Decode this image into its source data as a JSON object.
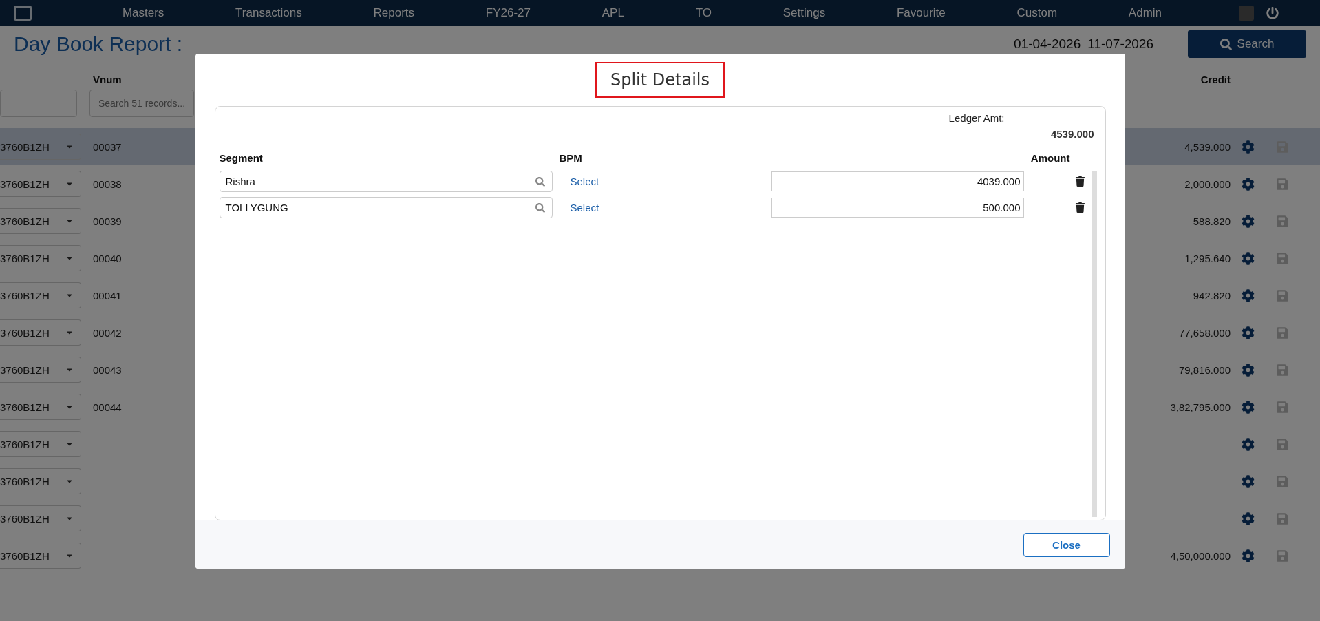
{
  "nav": {
    "items": [
      {
        "label": "Masters"
      },
      {
        "label": "Transactions"
      },
      {
        "label": "Reports"
      },
      {
        "label": "FY26-27"
      },
      {
        "label": "APL"
      },
      {
        "label": "TO"
      },
      {
        "label": "Settings"
      },
      {
        "label": "Favourite"
      },
      {
        "label": "Custom"
      },
      {
        "label": "Admin"
      }
    ]
  },
  "page": {
    "title": "Day Book Report :",
    "date_from": "01-04-2026",
    "date_to": "11-07-2026",
    "search_button": "Search"
  },
  "table": {
    "columns": [
      {
        "label": "Vnum"
      },
      {
        "label": "Credit"
      }
    ],
    "vnum_search_placeholder": "Search 51 records...",
    "rows": [
      {
        "account": "3760B1ZH",
        "vnum": "00037",
        "credit": "4,539.000",
        "selected": true
      },
      {
        "account": "3760B1ZH",
        "vnum": "00038",
        "credit": "2,000.000",
        "selected": false
      },
      {
        "account": "3760B1ZH",
        "vnum": "00039",
        "credit": "588.820",
        "selected": false
      },
      {
        "account": "3760B1ZH",
        "vnum": "00040",
        "credit": "1,295.640",
        "selected": false
      },
      {
        "account": "3760B1ZH",
        "vnum": "00041",
        "credit": "942.820",
        "selected": false
      },
      {
        "account": "3760B1ZH",
        "vnum": "00042",
        "credit": "77,658.000",
        "selected": false
      },
      {
        "account": "3760B1ZH",
        "vnum": "00043",
        "credit": "79,816.000",
        "selected": false
      },
      {
        "account": "3760B1ZH",
        "vnum": "00044",
        "credit": "3,82,795.000",
        "selected": false
      },
      {
        "account": "3760B1ZH",
        "selected": false
      },
      {
        "account": "3760B1ZH",
        "selected": false
      },
      {
        "account": "3760B1ZH",
        "selected": false
      },
      {
        "account": "3760B1ZH",
        "credit": "4,50,000.000",
        "selected": false
      }
    ]
  },
  "modal": {
    "title": "Split Details",
    "ledger_amt_label": "Ledger Amt:",
    "ledger_amt": "4539.000",
    "columns": [
      {
        "label": "Segment"
      },
      {
        "label": "BPM"
      },
      {
        "label": "Amount"
      }
    ],
    "rows": [
      {
        "segment": "Rishra",
        "bpm": "Select",
        "amount": "4039.000"
      },
      {
        "segment": "TOLLYGUNG",
        "bpm": "Select",
        "amount": "500.000"
      }
    ],
    "close_button": "Close"
  }
}
